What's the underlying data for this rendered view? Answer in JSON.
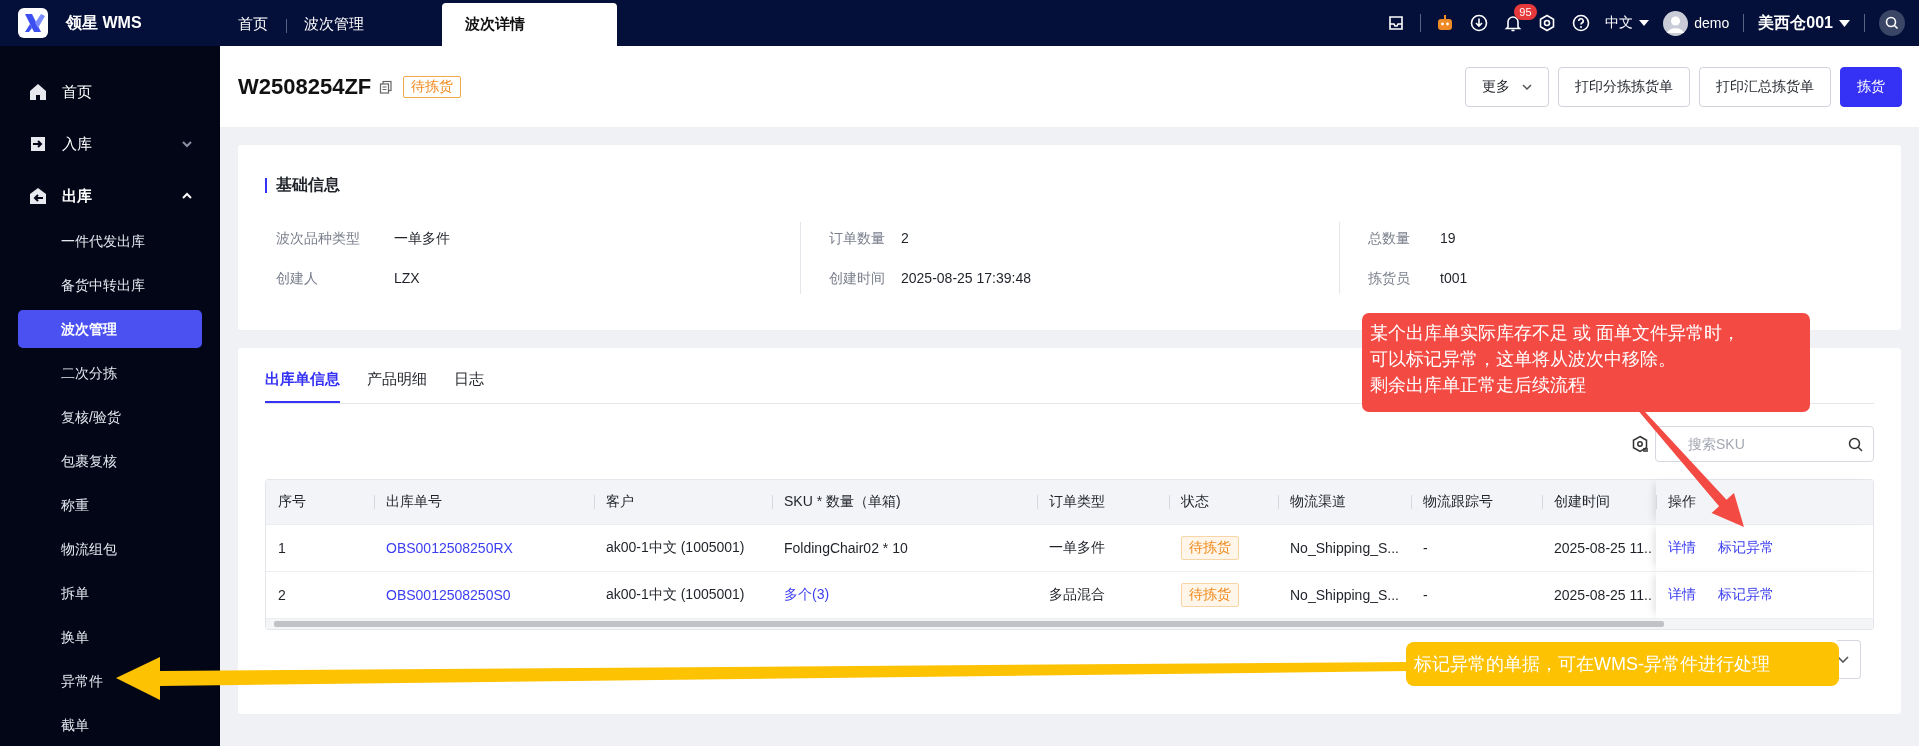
{
  "app": {
    "name": "领星 WMS"
  },
  "top_tabs": [
    {
      "label": "首页",
      "selected": false
    },
    {
      "label": "波次管理",
      "selected": false
    },
    {
      "label": "波次详情",
      "selected": true
    }
  ],
  "header_right": {
    "notification_count": "95",
    "language": "中文",
    "user": "demo",
    "warehouse": "美西仓001"
  },
  "sidebar": {
    "items": [
      {
        "label": "首页",
        "kind": "link"
      },
      {
        "label": "入库",
        "kind": "group",
        "expanded": false
      },
      {
        "label": "出库",
        "kind": "group",
        "expanded": true,
        "children": [
          {
            "label": "一件代发出库",
            "selected": false
          },
          {
            "label": "备货中转出库",
            "selected": false
          },
          {
            "label": "波次管理",
            "selected": true
          },
          {
            "label": "二次分拣",
            "selected": false
          },
          {
            "label": "复核/验货",
            "selected": false
          },
          {
            "label": "包裹复核",
            "selected": false
          },
          {
            "label": "称重",
            "selected": false
          },
          {
            "label": "物流组包",
            "selected": false
          },
          {
            "label": "拆单",
            "selected": false
          },
          {
            "label": "换单",
            "selected": false
          },
          {
            "label": "异常件",
            "selected": false
          },
          {
            "label": "截单",
            "selected": false
          }
        ]
      }
    ]
  },
  "page": {
    "title": "W2508254ZF",
    "status": "待拣货",
    "buttons": [
      {
        "label": "更多",
        "kind": "dropdown"
      },
      {
        "label": "打印分拣拣货单",
        "kind": "default"
      },
      {
        "label": "打印汇总拣货单",
        "kind": "default"
      },
      {
        "label": "拣货",
        "kind": "primary"
      }
    ]
  },
  "basic_info": {
    "title": "基础信息",
    "fields": [
      {
        "label": "波次品种类型",
        "value": "一单多件"
      },
      {
        "label": "订单数量",
        "value": "2"
      },
      {
        "label": "总数量",
        "value": "19"
      },
      {
        "label": "创建人",
        "value": "LZX"
      },
      {
        "label": "创建时间",
        "value": "2025-08-25 17:39:48"
      },
      {
        "label": "拣货员",
        "value": "t001"
      }
    ]
  },
  "detail_tabs": [
    {
      "label": "出库单信息",
      "selected": true
    },
    {
      "label": "产品明细",
      "selected": false
    },
    {
      "label": "日志",
      "selected": false
    }
  ],
  "search": {
    "placeholder": "搜索SKU"
  },
  "table": {
    "columns": [
      "序号",
      "出库单号",
      "客户",
      "SKU * 数量（单箱)",
      "订单类型",
      "状态",
      "物流渠道",
      "物流跟踪号",
      "创建时间",
      "操作"
    ],
    "rows": [
      {
        "index": "1",
        "order_no": "OBS0012508250RX",
        "customer": "ak00-1中文 (1005001)",
        "sku": {
          "text": "FoldingChair02 * 10",
          "kind": "text"
        },
        "order_type": "一单多件",
        "status": "待拣货",
        "channel": "No_Shipping_S...",
        "tracking": "-",
        "created": "2025-08-25 11..",
        "actions": [
          "详情",
          "标记异常"
        ]
      },
      {
        "index": "2",
        "order_no": "OBS0012508250S0",
        "customer": "ak00-1中文 (1005001)",
        "sku": {
          "text": "多个(3)",
          "kind": "link"
        },
        "order_type": "多品混合",
        "status": "待拣货",
        "channel": "No_Shipping_S...",
        "tracking": "-",
        "created": "2025-08-25 11..",
        "actions": [
          "详情",
          "标记异常"
        ]
      }
    ]
  },
  "annotations": [
    {
      "kind": "callout",
      "color": "#f44a44",
      "lines": [
        "某个出库单实际库存不足 或 面单文件异常时，",
        "可以标记异常，这单将从波次中移除。",
        "剩余出库单正常走后续流程"
      ]
    },
    {
      "kind": "note",
      "color": "#fdc201",
      "lines": [
        "标记异常的单据，可在WMS-异常件进行处理"
      ]
    }
  ]
}
